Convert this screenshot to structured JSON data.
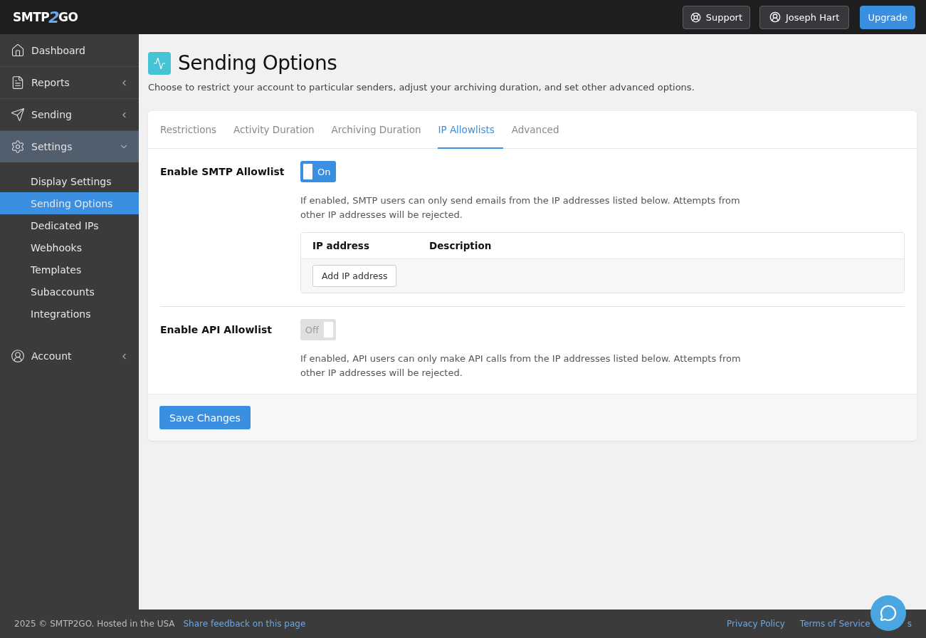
{
  "logo": {
    "left": "SMTP",
    "mark": "2",
    "right": "GO"
  },
  "topbar": {
    "support": "Support",
    "user": "Joseph Hart",
    "upgrade": "Upgrade"
  },
  "sidebar": {
    "items": [
      {
        "label": "Dashboard",
        "kind": "home",
        "expandable": false,
        "selected": false
      },
      {
        "label": "Reports",
        "kind": "file",
        "expandable": true,
        "expanded": false,
        "selected": false
      },
      {
        "label": "Sending",
        "kind": "send",
        "expandable": true,
        "expanded": false,
        "selected": false
      },
      {
        "label": "Settings",
        "kind": "gear",
        "expandable": true,
        "expanded": true,
        "selected": true,
        "children": [
          {
            "label": "Display Settings",
            "selected": false
          },
          {
            "label": "Sending Options",
            "selected": true
          },
          {
            "label": "Dedicated IPs",
            "selected": false
          },
          {
            "label": "Webhooks",
            "selected": false
          },
          {
            "label": "Templates",
            "selected": false
          },
          {
            "label": "Subaccounts",
            "selected": false
          },
          {
            "label": "Integrations",
            "selected": false
          }
        ]
      },
      {
        "label": "Account",
        "kind": "user",
        "expandable": true,
        "expanded": false,
        "selected": false
      }
    ]
  },
  "page": {
    "title": "Sending Options",
    "subtitle": "Choose to restrict your account to particular senders, adjust your archiving duration, and set other advanced options."
  },
  "tabs": [
    {
      "label": "Restrictions",
      "selected": false
    },
    {
      "label": "Activity Duration",
      "selected": false
    },
    {
      "label": "Archiving Duration",
      "selected": false
    },
    {
      "label": "IP Allowlists",
      "selected": true
    },
    {
      "label": "Advanced",
      "selected": false
    }
  ],
  "sections": [
    {
      "label": "Enable SMTP Allowlist",
      "on": true,
      "toggle_text": "On",
      "help": "If enabled, SMTP users can only send emails from the IP addresses listed below. Attempts from other IP addresses will be rejected.",
      "table": {
        "columns": [
          "IP address",
          "Description"
        ],
        "add_button": "Add IP address"
      }
    },
    {
      "label": "Enable API Allowlist",
      "on": false,
      "toggle_text": "Off",
      "help": "If enabled, API users can only make API calls from the IP addresses listed below. Attempts from other IP addresses will be rejected."
    }
  ],
  "save_button": "Save Changes",
  "footer": {
    "copyright": "2025 © SMTP2GO. Hosted in the USA",
    "feedback": "Share feedback on this page",
    "links": [
      "Privacy Policy",
      "Terms of Service",
      "s"
    ]
  }
}
